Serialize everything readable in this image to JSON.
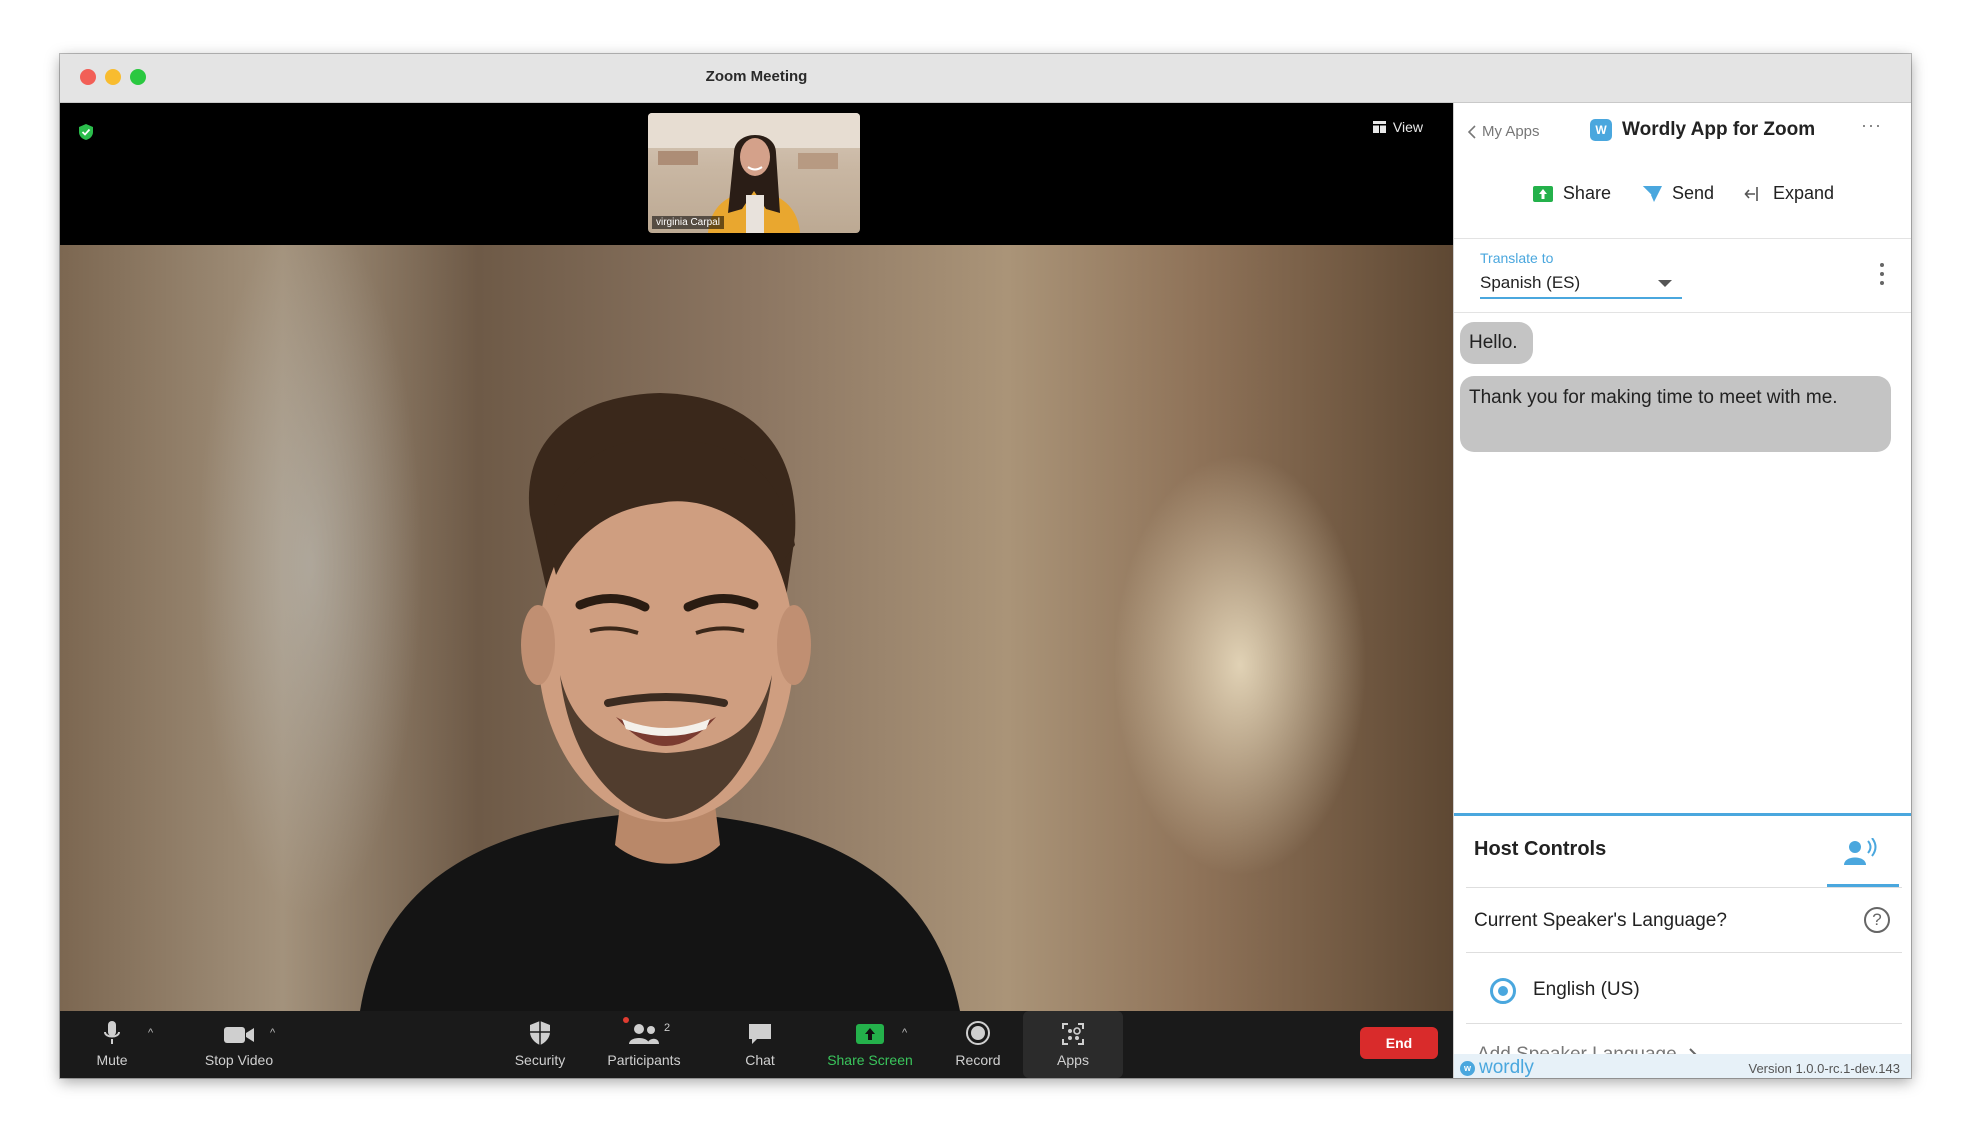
{
  "window": {
    "title": "Zoom Meeting"
  },
  "meeting": {
    "view_label": "View",
    "thumbnail_name": "virginia Carpal"
  },
  "toolbar": {
    "mute": "Mute",
    "stop_video": "Stop Video",
    "security": "Security",
    "participants": "Participants",
    "participants_count": "2",
    "chat": "Chat",
    "share_screen": "Share Screen",
    "record": "Record",
    "apps": "Apps",
    "end": "End"
  },
  "panel": {
    "back_label": "My Apps",
    "app_title": "Wordly App for Zoom",
    "app_logo_letter": "W",
    "actions": {
      "share": "Share",
      "send": "Send",
      "expand": "Expand"
    },
    "translate_label": "Translate to",
    "translate_value": "Spanish (ES)",
    "messages": [
      "Hello.",
      "Thank you for making time to meet with me."
    ],
    "host_controls": {
      "title": "Host Controls",
      "question": "Current Speaker's Language?",
      "help": "?",
      "selected_language": "English (US)",
      "add_language": "Add Speaker Language"
    },
    "footer": {
      "brand": "wordly",
      "brand_letter": "w",
      "version": "Version 1.0.0-rc.1-dev.143"
    }
  },
  "colors": {
    "accent": "#4aa7de",
    "end_button": "#d92b2b",
    "share_green": "#24b14b"
  },
  "icons": [
    "shield-icon",
    "grid-icon",
    "microphone-icon",
    "video-camera-icon",
    "security-shield-icon",
    "participants-icon",
    "chat-bubble-icon",
    "share-screen-icon",
    "record-icon",
    "apps-icon",
    "chevron-left-icon",
    "share-icon",
    "send-icon",
    "expand-icon",
    "kebab-icon",
    "help-icon",
    "speaker-icon",
    "chevron-right-icon"
  ]
}
